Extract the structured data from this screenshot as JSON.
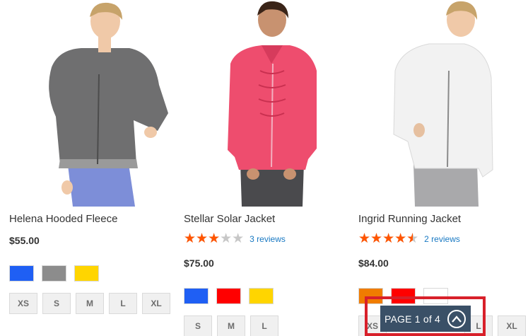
{
  "products": [
    {
      "name": "Helena Hooded Fleece",
      "price": "$55.00",
      "rating": null,
      "colors": [
        "#1f5ff4",
        "#8c8c8c",
        "#ffd500"
      ],
      "sizes": [
        "XS",
        "S",
        "M",
        "L",
        "XL"
      ]
    },
    {
      "name": "Stellar Solar Jacket",
      "price": "$75.00",
      "rating": {
        "stars": 3,
        "max": 5,
        "fraction": 0.6,
        "reviews_label": "3 reviews"
      },
      "colors": [
        "#1f5ff4",
        "#ff0000",
        "#ffd500"
      ],
      "sizes": [
        "S",
        "M",
        "L"
      ]
    },
    {
      "name": "Ingrid Running Jacket",
      "price": "$84.00",
      "rating": {
        "stars": 4.5,
        "max": 5,
        "fraction": 0.9,
        "reviews_label": "2 reviews"
      },
      "colors": [
        "#f07c00",
        "#ff0000",
        "#ffffff"
      ],
      "sizes": [
        "XS",
        "L",
        "XL"
      ]
    }
  ],
  "pager": {
    "label": "PAGE 1 of 4",
    "icon": "chevron-up-icon"
  },
  "stars_glyph": "★★★★★",
  "colors": {
    "star": "#ff5501",
    "link": "#1979c3",
    "pager_bg": "#3a5067",
    "highlight": "#d8202a"
  }
}
